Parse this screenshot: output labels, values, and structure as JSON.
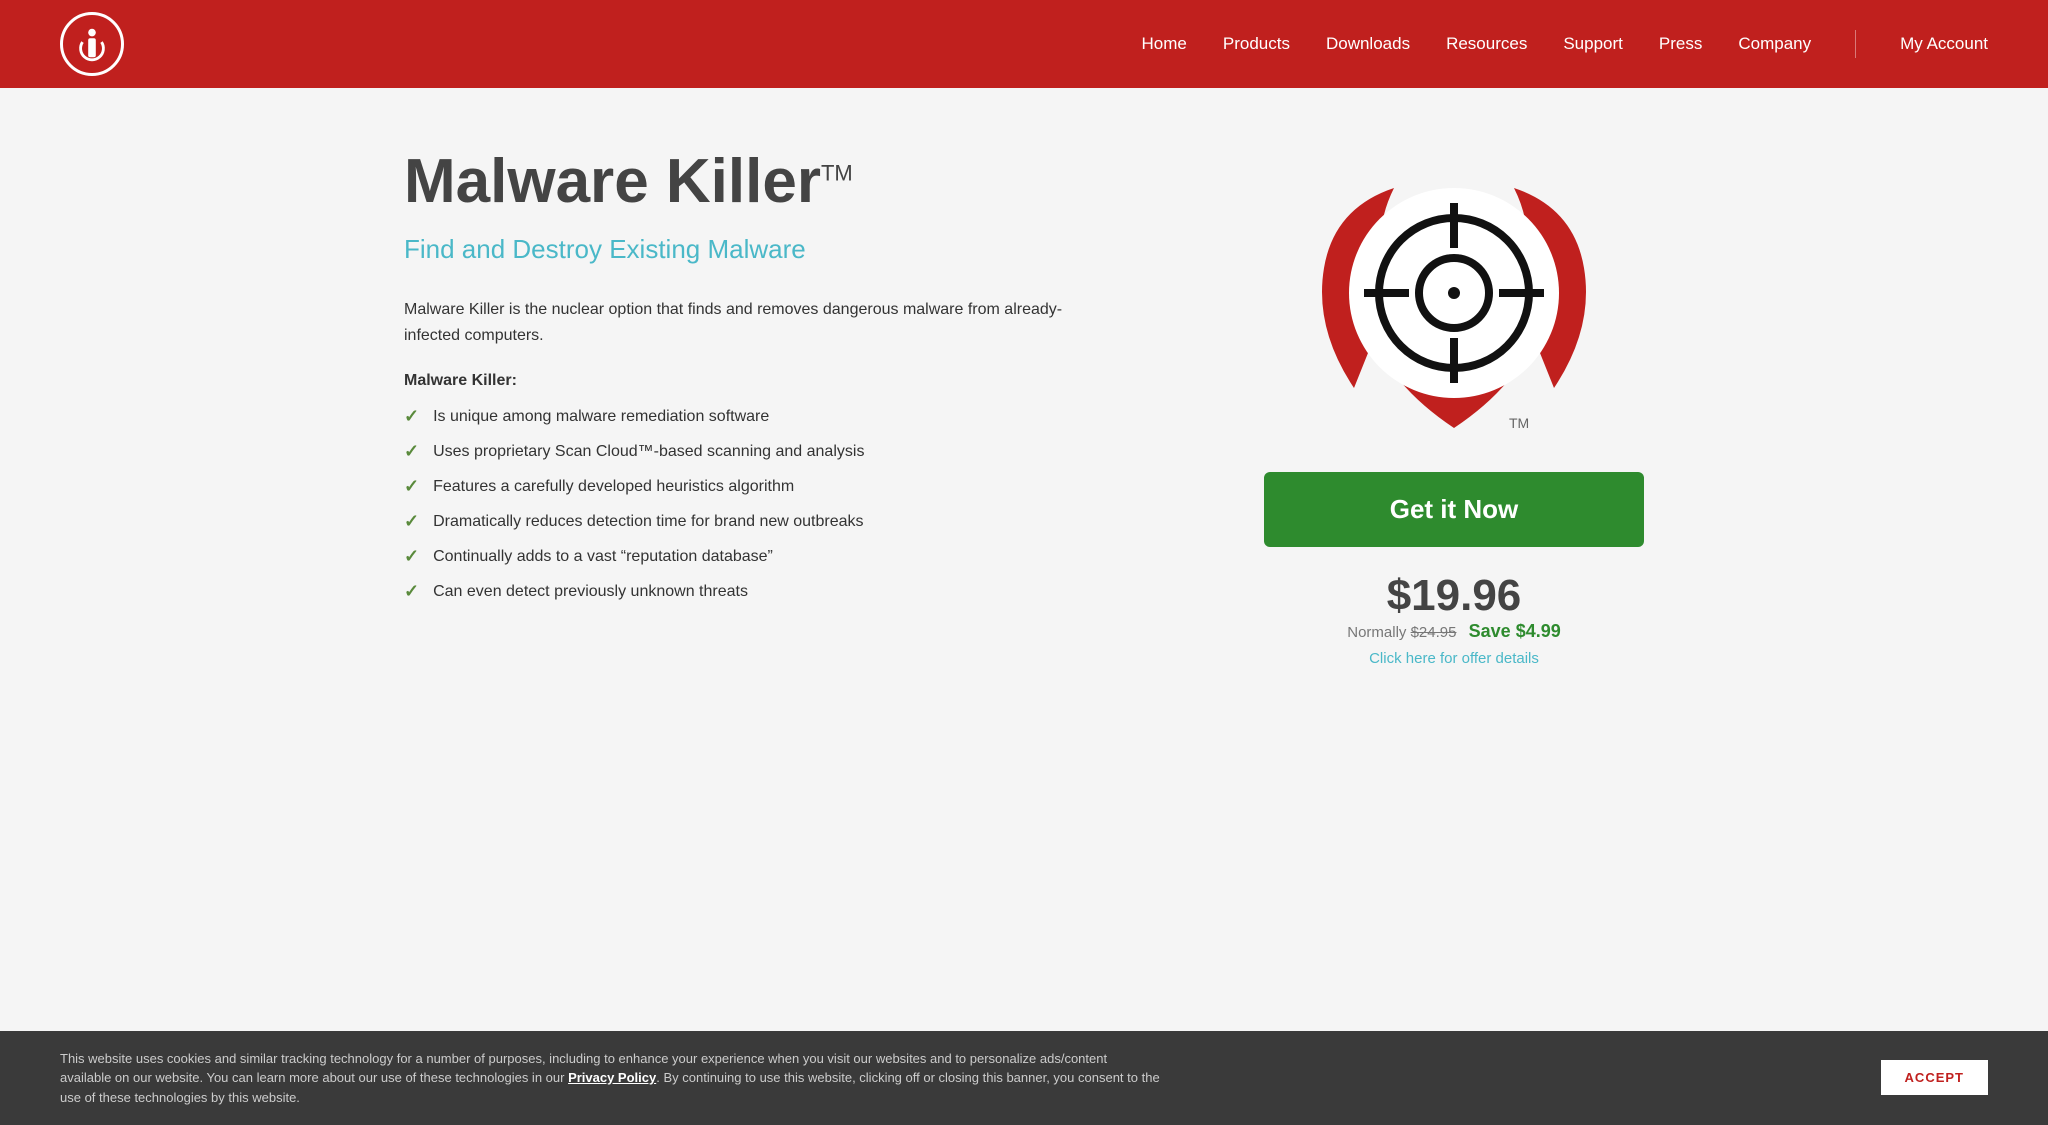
{
  "header": {
    "nav": {
      "home": "Home",
      "products": "Products",
      "downloads": "Downloads",
      "resources": "Resources",
      "support": "Support",
      "press": "Press",
      "company": "Company",
      "my_account": "My Account"
    }
  },
  "product": {
    "title": "Malware Killer",
    "trademark": "TM",
    "subtitle": "Find and Destroy Existing Malware",
    "description": "Malware Killer is the nuclear option that finds and removes dangerous malware from already-infected computers.",
    "list_title": "Malware Killer:",
    "features": [
      "Is unique among malware remediation software",
      "Uses proprietary Scan Cloud™-based scanning and analysis",
      "Features a carefully developed heuristics algorithm",
      "Dramatically reduces detection time for brand new outbreaks",
      "Continually adds to a vast “reputation database”",
      "Can even detect previously unknown threats"
    ],
    "cta_button": "Get it Now",
    "price": "$19.96",
    "normal_label": "Normally",
    "normal_price": "$24.95",
    "save_label": "Save $4.99",
    "offer_details": "Click here for offer details"
  },
  "cookie": {
    "text": "This website uses cookies and similar tracking technology for a number of purposes, including to enhance your experience when you visit our websites and to personalize ads/content available on our website. You can learn more about our use of these technologies in our Privacy Policy. By continuing to use this website, clicking off or closing this banner, you consent to the use of these technologies by this website.",
    "privacy_policy": "Privacy Policy",
    "accept": "ACCEPT"
  }
}
